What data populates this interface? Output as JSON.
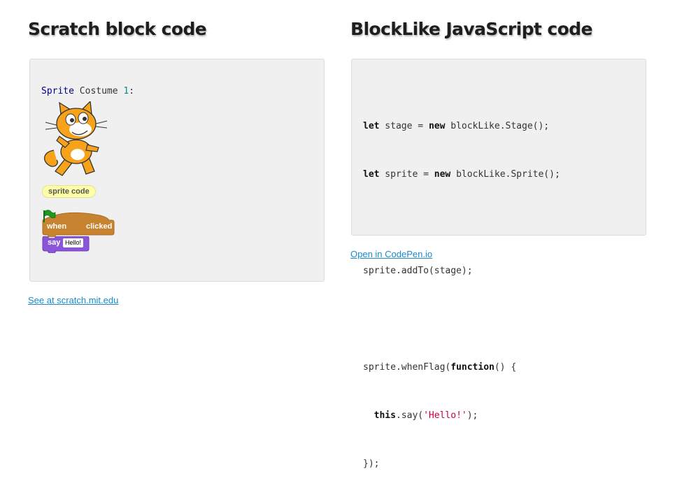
{
  "left": {
    "heading": "Scratch block code",
    "sprite_word": "Sprite",
    "costume_word": " Costume ",
    "costume_num": "1",
    "colon": ":",
    "comment": "sprite code",
    "event_when": "when",
    "event_clicked": "clicked",
    "say_label": "say",
    "say_value": "Hello!",
    "link": "See at scratch.mit.edu",
    "colors": {
      "event": "#c88330",
      "looks": "#8a55d7",
      "flag": "#1d9b1d"
    }
  },
  "right": {
    "heading": "BlockLike JavaScript code",
    "code": {
      "l1_kw": "let",
      "l1_a": " stage = ",
      "l1_kw2": "new",
      "l1_b": " blockLike.Stage();",
      "l2_kw": "let",
      "l2_a": " sprite = ",
      "l2_kw2": "new",
      "l2_b": " blockLike.Sprite();",
      "l4": "sprite.addTo(stage);",
      "l6_a": "sprite.whenFlag(",
      "l6_kw": "function",
      "l6_b": "() {",
      "l7_pre": "  ",
      "l7_kw": "this",
      "l7_a": ".say(",
      "l7_str": "'Hello!'",
      "l7_b": ");",
      "l8": "});"
    },
    "link": "Open in CodePen.io"
  }
}
